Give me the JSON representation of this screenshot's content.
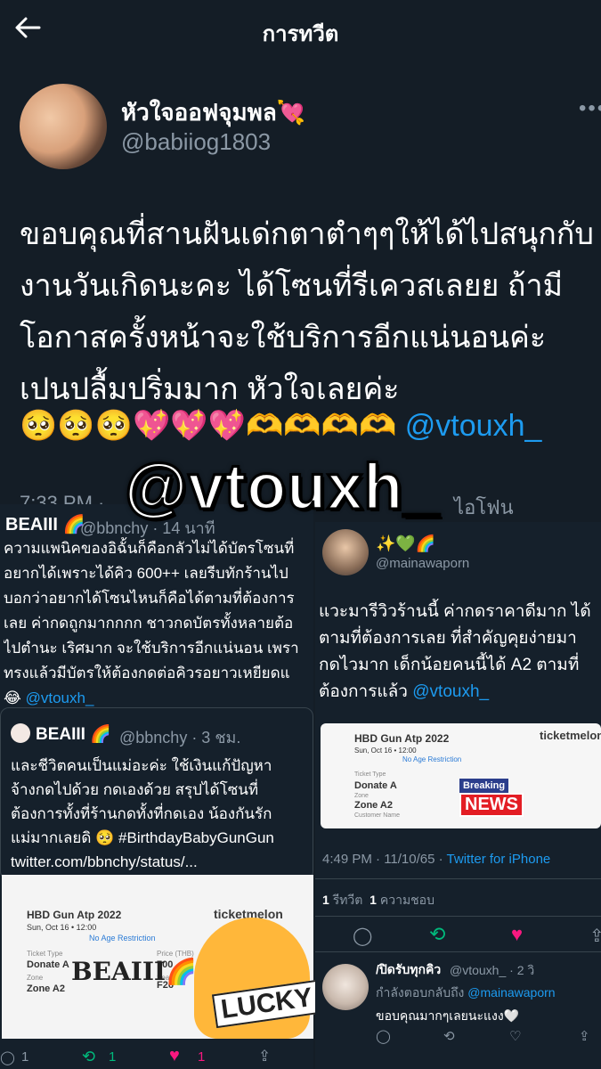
{
  "header": {
    "title": "การทวีต"
  },
  "tweet": {
    "display_name": "หัวใจออฟจุมพล",
    "name_emoji": "💘",
    "handle": "@babiiog1803",
    "more": "•••",
    "text": "ขอบคุณที่สานฝันเด่กตาตำๆๆให้ได้ไปสนุกกับงานวันเกิดนะคะ ได้โซนที่รีเควสเลยย ถ้ามีโอกาสครั้งหน้าจะใช้บริการอีกแน่นอนค่ะ เปนปลื้มปริ่มมาก หัวใจเลยค่ะ",
    "emojis": "🥺🥺🥺💖💖💖🫶🫶🫶🫶 ",
    "mention": "@vtouxh_"
  },
  "overlay_text": "@vtouxh_",
  "faded_time": "7:33 PM · ",
  "faded_right": "ไอโฟน",
  "left_shot": {
    "name": "BEAIII 🌈",
    "handle": "@bbnchy · 14 นาที",
    "lines": [
      "ความแพนิคของอิฉั้นก็คือกลัวไม่ได้บัตรโซนที่",
      "อยากได้เพราะได้คิว 600++ เลยรีบทักร้านไป",
      "บอกว่าอยากได้โซนไหนก็คือได้ตามที่ต้องการ",
      "เลย ค่ากดถูกมากกกก ชาวกดบัตรทั้งหลายต้อ",
      "ไปตำนะ เริศมาก จะใช้บริการอีกแน่นอน เพรา",
      "ทรงแล้วมีบัตรให้ต้องกดต่อคิวรอยาวเหยียดแ"
    ],
    "last_line_emoji": "😂 ",
    "last_line_mention": "@vtouxh_",
    "quote": {
      "name": "BEAIII 🌈",
      "handle": "@bbnchy · 3 ชม.",
      "lines": [
        "และชีวิตคนเป็นแม่อะค่ะ ใช้เงินแก้ปัญหา",
        "จ้างกดไปด้วย กดเองด้วย สรุปได้โซนที่",
        "ต้องการทั้งที่ร้านกดทั้งที่กดเอง น้องกันรัก",
        "แม่มากเลยดิ 🥺 #BirthdayBabyGunGun",
        "twitter.com/bbnchy/status/..."
      ]
    },
    "ticket": {
      "title": "HBD Gun Atp 2022",
      "date": "Sun, Oct 16 • 12:00",
      "restriction": "No Age Restriction",
      "type_label": "Ticket Type",
      "type": "Donate A",
      "zone_label": "Zone",
      "zone": "Zone A2",
      "price_label": "Price (THB)",
      "price": "700",
      "seat_label": "Seat",
      "seat": "F26",
      "logo": "ticketmelon",
      "sticker_text": "BEAIII🌈",
      "lucky": "LUCKY"
    },
    "actions": {
      "reply": "1",
      "retweet": "1",
      "like": "1"
    }
  },
  "right_shot": {
    "emojis": "✨💚🌈",
    "handle": "@mainawaporn",
    "lines": [
      "แวะมารีวิวร้านนี้ ค่ากดราคาดีมาก ได้",
      "ตามที่ต้องการเลย  ที่สำคัญคุยง่ายมา",
      "กดไวมาก เด็กน้อยคนนี้ได้ A2 ตามที่"
    ],
    "last_line": "ต้องการแล้ว ",
    "last_mention": "@vtouxh_",
    "ticket": {
      "title": "HBD Gun Atp 2022",
      "date": "Sun, Oct 16 • 12:00",
      "restriction": "No Age Restriction",
      "type_label": "Ticket Type",
      "type": "Donate A",
      "zone_label": "Zone",
      "zone": "Zone A2",
      "customer_label": "Customer Name",
      "logo": "ticketmelon",
      "breaking": "Breaking",
      "news": "NEWS"
    },
    "time": "4:49 PM · 11/10/65 · ",
    "source": "Twitter for iPhone",
    "retweets_count": "1",
    "retweets_label": "รีทวีต",
    "likes_count": "1",
    "likes_label": "ความชอบ",
    "reply": {
      "name": "/ปิดรับทุกคิว",
      "handle": "@vtouxh_ · 2 วิ",
      "replying_to": "กำลังตอบกลับถึง ",
      "replying_mention": "@mainawaporn",
      "text": "ขอบคุณมากๆเลยนะแงง🤍"
    }
  },
  "colors": {
    "background": "#141d26",
    "accent": "#1d9bf0",
    "like": "#f91880",
    "retweet": "#00ba7c",
    "muted": "#8b98a5"
  }
}
